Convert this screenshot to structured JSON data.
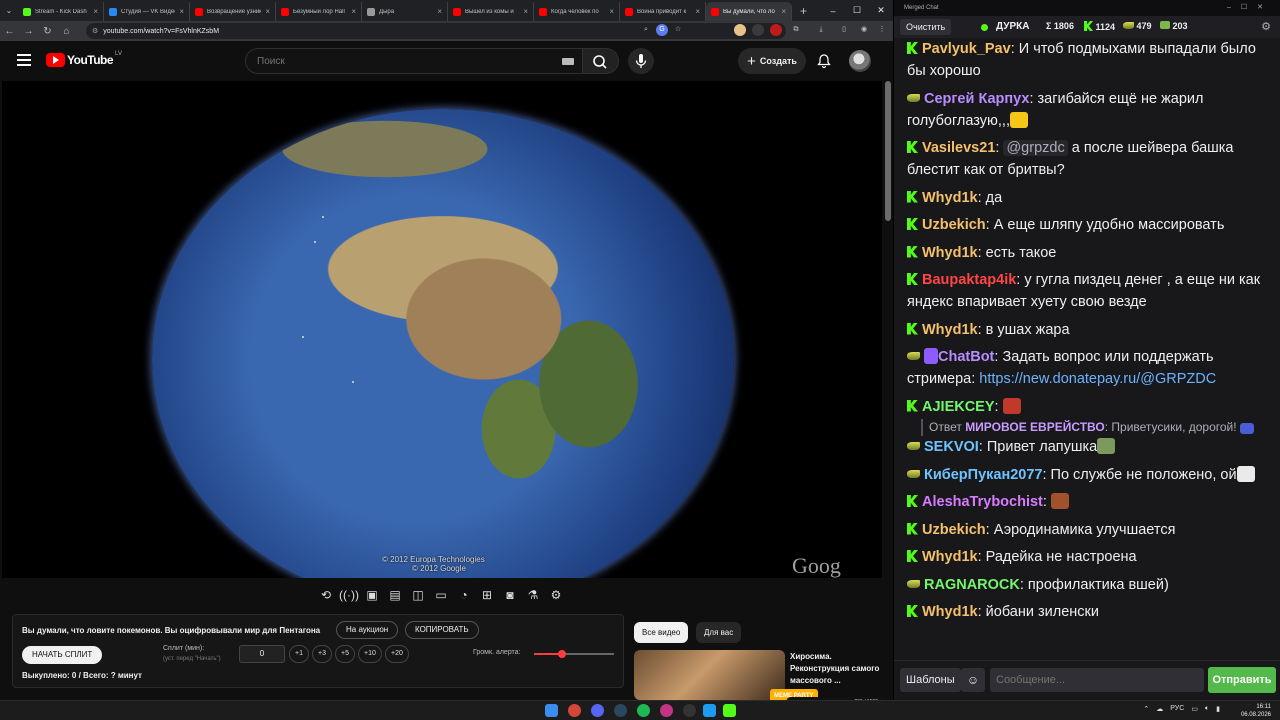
{
  "browser": {
    "tabs": [
      {
        "title": "Stream - Kick Dash",
        "color": "#53fc18",
        "active": false
      },
      {
        "title": "Студия — VK Видео",
        "color": "#2787f5",
        "active": false
      },
      {
        "title": "Возвращение узник",
        "color": "#ff0000",
        "active": false
      },
      {
        "title": "Безумный лор Hall",
        "color": "#ff0000",
        "active": false
      },
      {
        "title": "Дыра",
        "color": "#999999",
        "active": false
      },
      {
        "title": "Вышел из комы и",
        "color": "#ff0000",
        "active": false
      },
      {
        "title": "Когда человек по",
        "color": "#ff0000",
        "active": false
      },
      {
        "title": "Война приводит к",
        "color": "#ff0000",
        "active": false
      },
      {
        "title": "Вы думали, что ло",
        "color": "#ff0000",
        "active": true
      }
    ],
    "new_tab": "+",
    "url": "youtube.com/watch?v=FsVhlnKZsbM"
  },
  "youtube": {
    "logo_text": "YouTube",
    "country": "LV",
    "search_placeholder": "Поиск",
    "create_label": "Создать",
    "video": {
      "copyright": "© 2012 Europa Technologies",
      "copyright2": "© 2012 Google",
      "watermark": "Goog"
    },
    "split_panel": {
      "title": "Вы думали, что ловите покемонов. Вы оцифровывали мир для Пентагона",
      "auction_label": "На аукцион",
      "copy_label": "КОПИРОВАТЬ",
      "start_label": "НАЧАТЬ СПЛИТ",
      "split_label": "Сплит (мин):",
      "split_sub": "(уст. перед \"Начать\")",
      "split_value": "0",
      "increments": [
        "+1",
        "+3",
        "+5",
        "+10",
        "+20"
      ],
      "alert_label": "Громк. алерта:",
      "alert_level": 0.35,
      "bought": "Выкуплено: 0 / Всего: ? минут"
    },
    "chips": [
      "Все видео",
      "Для вас"
    ],
    "rec": {
      "title": "Хиросима. Реконструкция самого массового ...",
      "meme_badge": "MEME PARTY",
      "meme_progress": "200 / 1500"
    }
  },
  "chat": {
    "window_title": "Merged Chat",
    "clear_label": "Очистить",
    "streamer": "ДУРКА",
    "stats": [
      {
        "icon": "Σ",
        "value": "1806"
      },
      {
        "icon": "kick",
        "value": "1124"
      },
      {
        "icon": "sub",
        "value": "479"
      },
      {
        "icon": "cash",
        "value": "203"
      }
    ],
    "messages": [
      {
        "badge": "kick",
        "user": "Pavlyuk_Pav",
        "color": "#f4c06b",
        "text": "И чтоб подмыхами выпадали было бы хорошо"
      },
      {
        "badge": "sub",
        "user": "Сергей Карпух",
        "color": "#b98cff",
        "text": "загибайся  ещё не жарил голубоглазую,,,"
      },
      {
        "badge": "kick",
        "user": "Vasilevs21",
        "color": "#f4c06b",
        "mention": "@grpzdc",
        "text": "а после шейвера башка блестит как от бритвы?"
      },
      {
        "badge": "kick",
        "user": "Whyd1k",
        "color": "#f4c06b",
        "text": "да"
      },
      {
        "badge": "kick",
        "user": "Uzbekich",
        "color": "#f4c06b",
        "text": "А еще шляпу удобно массировать"
      },
      {
        "badge": "kick",
        "user": "Whyd1k",
        "color": "#f4c06b",
        "text": "есть такое"
      },
      {
        "badge": "kick",
        "user": "Baupaktap4ik",
        "color": "#ff4545",
        "text": "у гугла пиздец денег , а еще ни как яндекс впаривает хуету свою везде"
      },
      {
        "badge": "kick",
        "user": "Whyd1k",
        "color": "#f4c06b",
        "text": "в ушах жара"
      },
      {
        "badge": "sub",
        "user": "ChatBot",
        "color": "#b98cff",
        "text": "Задать вопрос или поддержать стримера:",
        "link": "https://new.donatepay.ru/@GRPZDC"
      },
      {
        "badge": "kick",
        "user": "AJIEKCEY",
        "color": "#74f56b",
        "text": ""
      },
      {
        "badge": "sub",
        "user": "SEKVOI",
        "color": "#6ec3ff",
        "text": "Привет лапушка"
      },
      {
        "badge": "sub",
        "user": "КиберПукан2077",
        "color": "#6ec3ff",
        "text": "По службе не положено, ой"
      },
      {
        "badge": "kick",
        "user": "AleshaTrybochist",
        "color": "#d77bff",
        "text": ""
      },
      {
        "badge": "kick",
        "user": "Uzbekich",
        "color": "#f4c06b",
        "text": "Аэродинамика улучшается"
      },
      {
        "badge": "kick",
        "user": "Whyd1k",
        "color": "#f4c06b",
        "text": "Радейка не настроена"
      },
      {
        "badge": "sub",
        "user": "RAGNAROCK",
        "color": "#74f56b",
        "text": "профилактика вшей)"
      },
      {
        "badge": "kick",
        "user": "Whyd1k",
        "color": "#f4c06b",
        "text": "йобани зиленски"
      }
    ],
    "reply": {
      "prefix": "Ответ",
      "user": "МИРОВОЕ ЕВРЕЙСТВО",
      "text": "Приветусики, дорогой!"
    },
    "templates_label": "Шаблоны",
    "input_placeholder": "Сообщение...",
    "send_label": "Отправить"
  },
  "taskbar": {
    "lang": "РУС",
    "time": "16:11",
    "date": "06.08.2026"
  }
}
